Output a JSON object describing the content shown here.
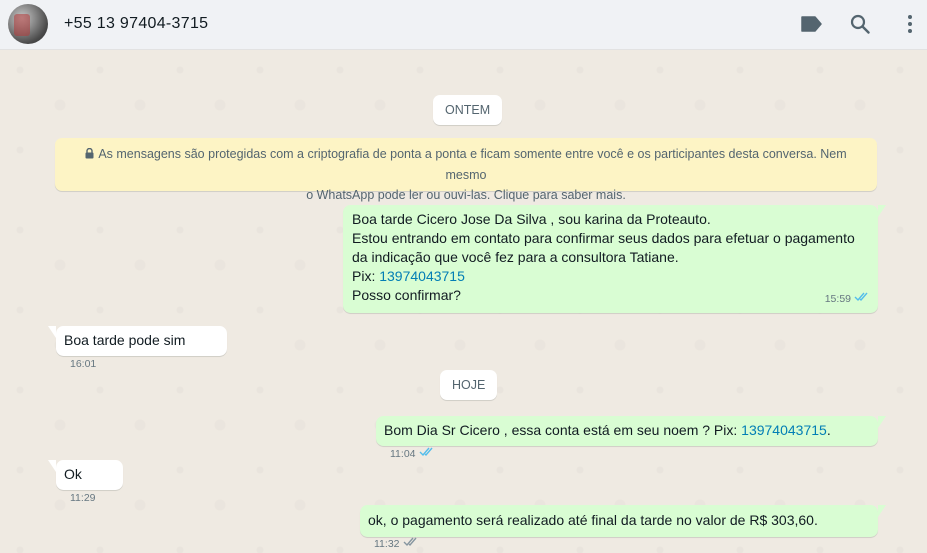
{
  "header": {
    "contact_name": "+55 13 97404-3715",
    "icons": [
      "label-icon",
      "search-icon",
      "menu-icon"
    ]
  },
  "chat": {
    "day_yesterday": "ONTEM",
    "day_today": "HOJE",
    "encryption_notice_line1": "As mensagens são protegidas com a criptografia de ponta a ponta e ficam somente entre você e os participantes desta conversa. Nem mesmo",
    "encryption_notice_line2": "o WhatsApp pode ler ou ouvi-las. Clique para saber mais.",
    "messages": [
      {
        "direction": "out",
        "line1": "Boa tarde Cicero Jose Da Silva  , sou karina da Proteauto.",
        "line2": "Estou entrando em contato para confirmar seus dados para efetuar o pagamento",
        "line3": "da indicação que você fez para a consultora Tatiane.",
        "line4_prefix": "Pix: ",
        "line4_link": "13974043715",
        "line5": "Posso confirmar?",
        "time": "15:59",
        "status": "read"
      },
      {
        "direction": "in",
        "text": "Boa tarde pode sim",
        "time": "16:01"
      },
      {
        "direction": "out",
        "text_prefix": "Bom Dia Sr Cicero , essa conta está em seu noem ? Pix: ",
        "text_link": "13974043715",
        "text_suffix": ".",
        "time": "11:04",
        "status": "read"
      },
      {
        "direction": "in",
        "text": "Ok",
        "time": "11:29"
      },
      {
        "direction": "out",
        "text": "ok, o pagamento será realizado até final da tarde no valor de R$ 303,60.",
        "time": "11:32",
        "status": "delivered"
      }
    ]
  },
  "colors": {
    "outgoing_bubble": "#d9fdd3",
    "incoming_bubble": "#ffffff",
    "notice_bg": "#fdf4c5",
    "link": "#027eb5",
    "read_ticks": "#53bdeb",
    "delivered_ticks": "#8696a0"
  }
}
